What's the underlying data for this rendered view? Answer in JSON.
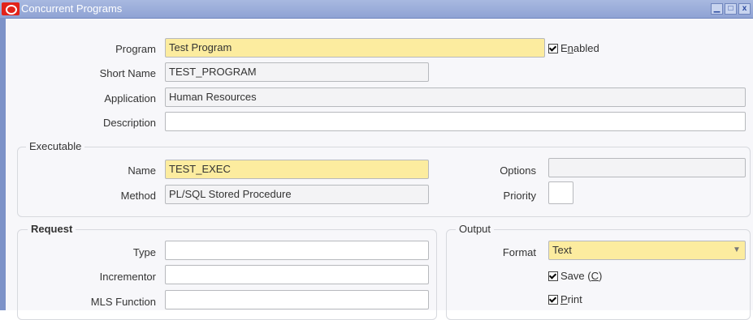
{
  "window": {
    "title": "Concurrent Programs",
    "controls": {
      "minimize": "▁",
      "maximize": "□",
      "close": "x"
    }
  },
  "program": {
    "program_label": "Program",
    "program_value": "Test Program",
    "enabled_label_pre": "E",
    "enabled_label_u": "n",
    "enabled_label_post": "abled",
    "enabled_checked": true,
    "short_name_label": "Short Name",
    "short_name_value": "TEST_PROGRAM",
    "application_label": "Application",
    "application_value": "Human Resources",
    "description_label": "Description",
    "description_value": ""
  },
  "executable": {
    "group_label": "Executable",
    "name_label": "Name",
    "name_value": "TEST_EXEC",
    "method_label": "Method",
    "method_value": "PL/SQL Stored Procedure",
    "options_label": "Options",
    "options_value": "",
    "priority_label": "Priority",
    "priority_value": ""
  },
  "request": {
    "group_label": "Request",
    "type_label": "Type",
    "type_value": "",
    "incrementor_label": "Incrementor",
    "incrementor_value": "",
    "mls_label": "MLS Function",
    "mls_value": ""
  },
  "output": {
    "group_label": "Output",
    "format_label": "Format",
    "format_value": "Text",
    "save_label_pre": "Save (",
    "save_label_u": "C",
    "save_label_post": ")",
    "save_checked": true,
    "print_label_u": "P",
    "print_label_post": "rint",
    "print_checked": true
  }
}
